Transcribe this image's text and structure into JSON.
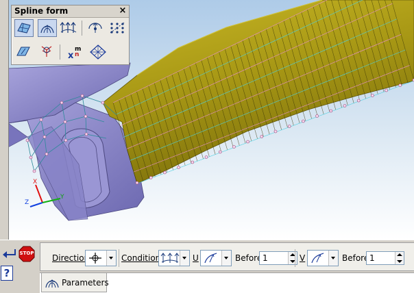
{
  "palette": {
    "title": "Spline form",
    "close_glyph": "×",
    "tools_row1": [
      "surface-patch-icon",
      "spline-form-icon",
      "control-vectors-icon",
      "rotate-handle-icon",
      "point-grid-icon"
    ],
    "tools_row2": [
      "plane-icon",
      "tree-form-icon",
      "xmn-degree-icon",
      "diamond-grid-icon"
    ],
    "xmn_label": {
      "x": "x",
      "m": "m",
      "n": "n"
    }
  },
  "axis": {
    "x": "X",
    "y": "Y",
    "z": "Z"
  },
  "toolbar": {
    "direction_label": "Direction",
    "conditions_label": "Conditions",
    "u_label": "U",
    "v_label": "V",
    "before_label_1": "Before",
    "before_value_1": "1",
    "before_label_2": "Before",
    "before_value_2": "1"
  },
  "left_panel": {
    "stop_label": "STOP",
    "help_glyph": "?"
  },
  "tabs": [
    {
      "label": "Parameters"
    }
  ],
  "colors": {
    "surface_gold": "#a99a12",
    "part_purple": "#8c88c8",
    "mesh_cyan": "#4dd0e0",
    "mesh_pink": "#e890d0",
    "stop_red": "#d01010"
  }
}
